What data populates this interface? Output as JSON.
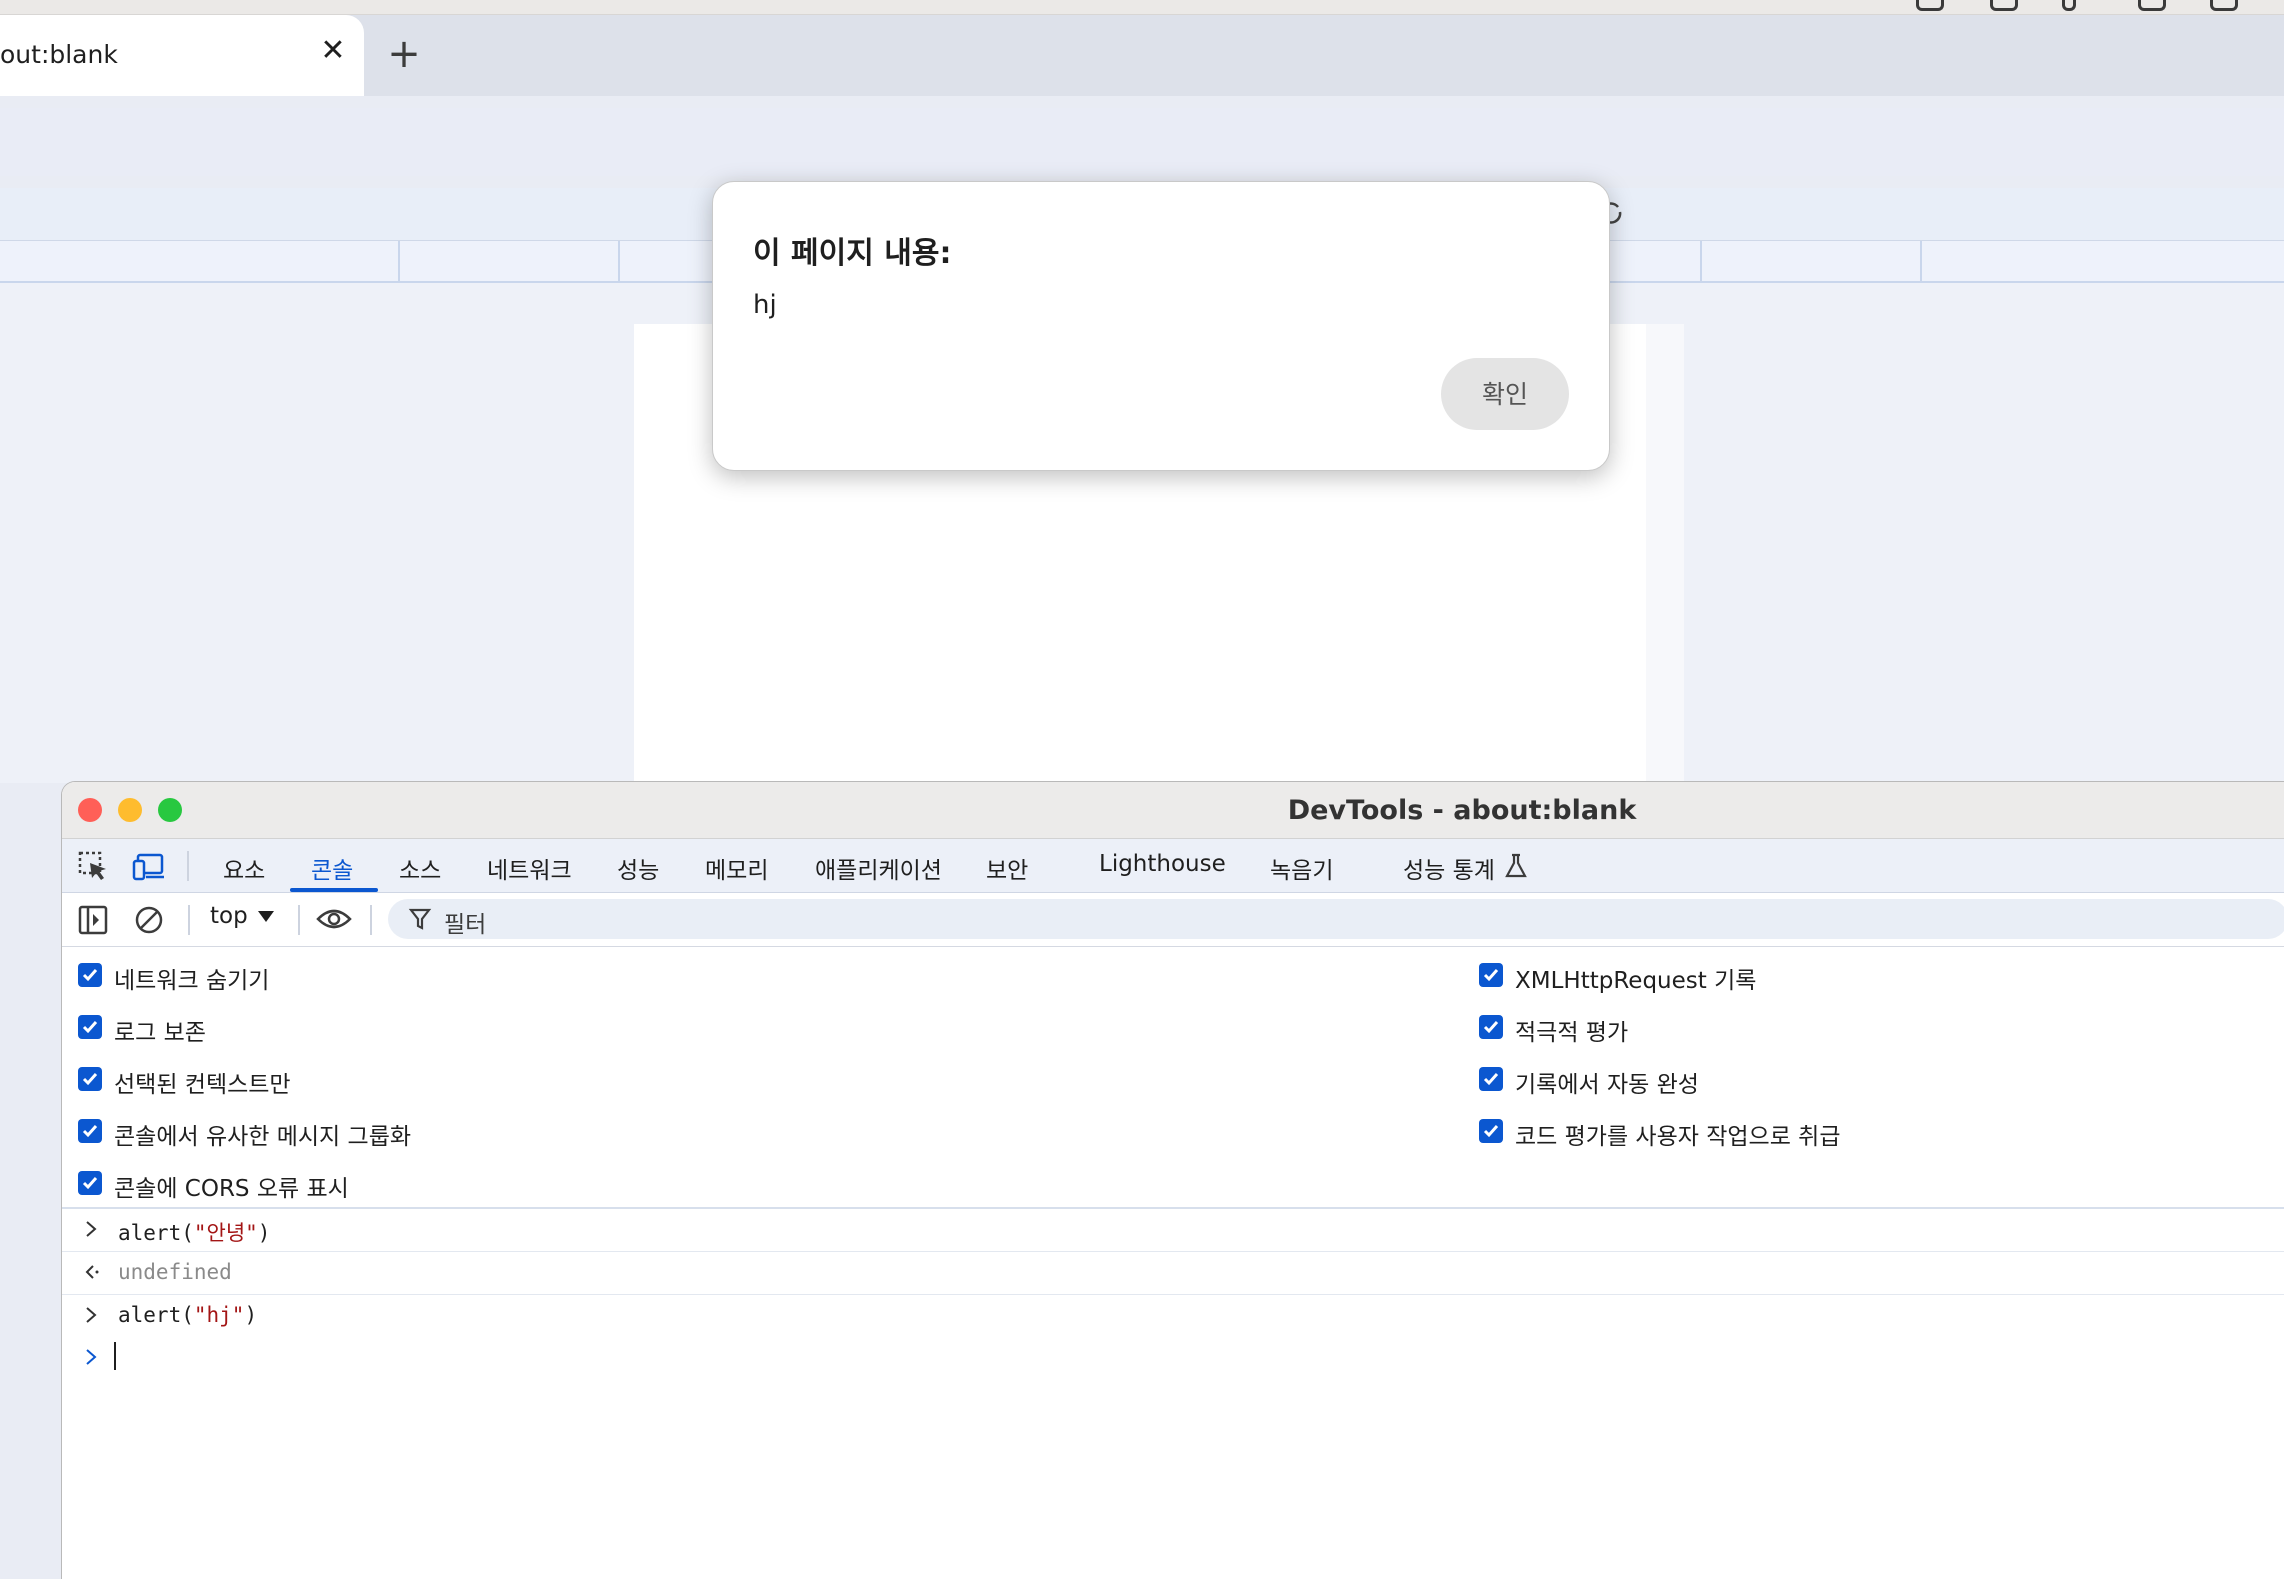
{
  "browser": {
    "tab_title": "out:blank",
    "close_glyph": "✕",
    "new_tab_glyph": "+"
  },
  "alert": {
    "heading": "이 페이지 내용:",
    "message": "hj",
    "ok_label": "확인"
  },
  "devtools": {
    "window_title": "DevTools - about:blank",
    "tabs": [
      {
        "label": "요소",
        "active": false
      },
      {
        "label": "콘솔",
        "active": true
      },
      {
        "label": "소스",
        "active": false
      },
      {
        "label": "네트워크",
        "active": false
      },
      {
        "label": "성능",
        "active": false
      },
      {
        "label": "메모리",
        "active": false
      },
      {
        "label": "애플리케이션",
        "active": false
      },
      {
        "label": "보안",
        "active": false
      },
      {
        "label": "Lighthouse",
        "active": false
      },
      {
        "label": "녹음기",
        "active": false
      },
      {
        "label": "성능 통계",
        "active": false
      }
    ],
    "context": "top",
    "filter_placeholder": "필터",
    "settings_left": [
      {
        "label": "네트워크 숨기기",
        "checked": true
      },
      {
        "label": "로그 보존",
        "checked": true
      },
      {
        "label": "선택된 컨텍스트만",
        "checked": true
      },
      {
        "label": "콘솔에서 유사한 메시지 그룹화",
        "checked": true
      },
      {
        "label": "콘솔에 CORS 오류 표시",
        "checked": true
      }
    ],
    "settings_right": [
      {
        "label": "XMLHttpRequest 기록",
        "checked": true
      },
      {
        "label": "적극적 평가",
        "checked": true
      },
      {
        "label": "기록에서 자동 완성",
        "checked": true
      },
      {
        "label": "코드 평가를 사용자 작업으로 취급",
        "checked": true
      }
    ],
    "console": [
      {
        "kind": "input",
        "prefix": "alert(",
        "string": "\"안녕\"",
        "suffix": ")"
      },
      {
        "kind": "result",
        "text": "undefined"
      },
      {
        "kind": "input",
        "prefix": "alert(",
        "string": "\"hj\"",
        "suffix": ")"
      }
    ]
  },
  "colors": {
    "accent": "#0b57d0",
    "string": "#a31515",
    "close_red": "#ff5f57",
    "minimize_yellow": "#febc2e",
    "zoom_green": "#28c840"
  }
}
